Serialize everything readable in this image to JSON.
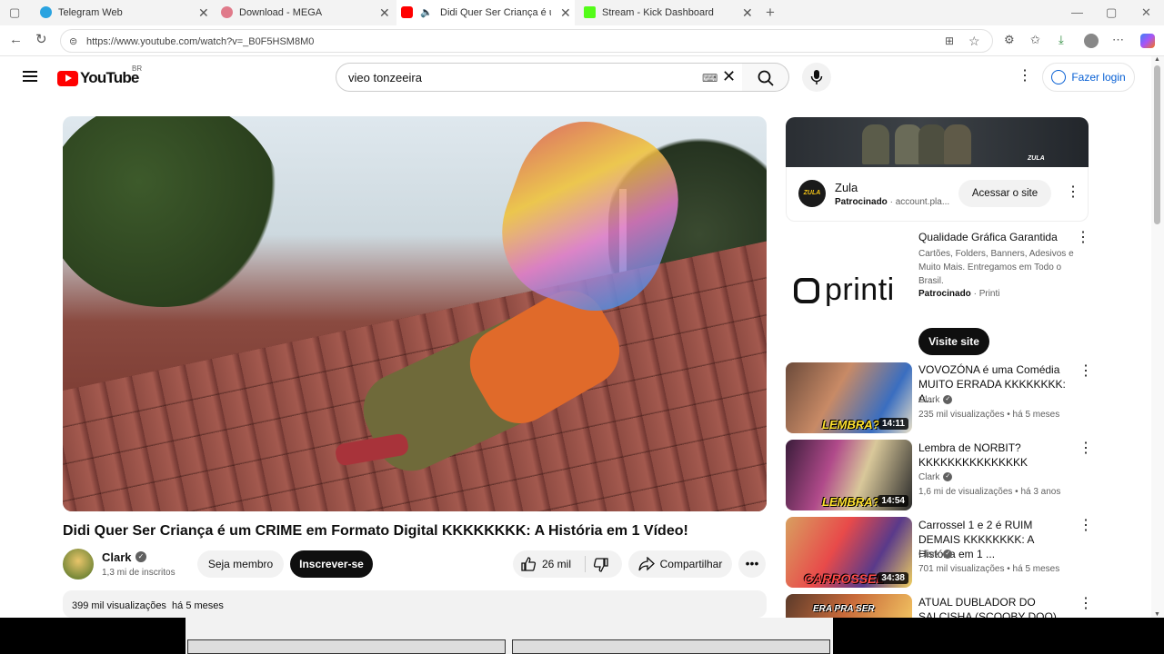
{
  "browser": {
    "tabs": [
      {
        "label": "Telegram Web",
        "favicon_color": "#2aa3e0"
      },
      {
        "label": "Download - MEGA",
        "favicon_color": "#e07a8a"
      },
      {
        "label": "Didi Quer Ser Criança é um C",
        "favicon_color": "#ff0000"
      },
      {
        "label": "Stream - Kick Dashboard",
        "favicon_color": "#53fc18"
      }
    ],
    "url": "https://www.youtube.com/watch?v=_B0F5HSM8M0"
  },
  "header": {
    "logo_text": "YouTube",
    "country_code": "BR",
    "search_value": "vieo tonzeeira",
    "login_label": "Fazer login"
  },
  "video": {
    "title": "Didi Quer Ser Criança é um CRIME em Formato Digital KKKKKKKK: A História em 1 Vídeo!",
    "channel": "Clark",
    "subscribers": "1,3 mi de inscritos",
    "member_label": "Seja membro",
    "subscribe_label": "Inscrever-se",
    "likes": "26 mil",
    "share_label": "Compartilhar",
    "views_date": "399 mil visualizações  há 5 meses"
  },
  "sidebar": {
    "ad1": {
      "banner_brand": "ZULA",
      "name": "Zula",
      "sponsored": "Patrocinado",
      "domain": "account.pla...",
      "cta": "Acessar o site",
      "logo_text": "ZULA"
    },
    "ad2": {
      "logo_text": "printi",
      "title": "Qualidade Gráfica Garantida",
      "desc": "Cartões, Folders, Banners, Adesivos e Muito Mais. Entregamos em Todo o Brasil.",
      "sponsored": "Patrocinado",
      "brand": "Printi",
      "cta": "Visite site"
    },
    "videos": [
      {
        "title": "VOVOZÓNA é uma Comédia MUITO ERRADA KKKKKKKK: A...",
        "channel": "Clark",
        "meta": "235 mil visualizações • há 5 meses",
        "duration": "14:11",
        "overlay": "LEMBRA?"
      },
      {
        "title": "Lembra de NORBIT? KKKKKKKKKKKKKKK",
        "channel": "Clark",
        "meta": "1,6 mi de visualizações • há 3 anos",
        "duration": "14:54",
        "overlay": "LEMBRA?"
      },
      {
        "title": "Carrossel 1 e 2 é RUIM DEMAIS KKKKKKKK: A História em 1 ...",
        "channel": "Clark",
        "meta": "701 mil visualizações • há 5 meses",
        "duration": "34:38",
        "overlay": "CARROSSEL"
      },
      {
        "title": "ATUAL DUBLADOR DO SALCISHA (SCOOBY DOO)",
        "channel": "",
        "meta": "",
        "duration": "",
        "overlay": "ERA PRA SER"
      }
    ]
  },
  "colors": {
    "yt_red": "#ff0000",
    "link_blue": "#065fd4",
    "subscribe_bg": "#0f0f0f",
    "chip_bg": "#f2f2f2"
  },
  "icons": [
    "hamburger-icon",
    "youtube-logo-icon",
    "keyboard-icon",
    "clear-icon",
    "search-icon",
    "mic-icon",
    "more-icon",
    "user-icon",
    "like-icon",
    "dislike-icon",
    "share-icon",
    "verified-icon"
  ]
}
